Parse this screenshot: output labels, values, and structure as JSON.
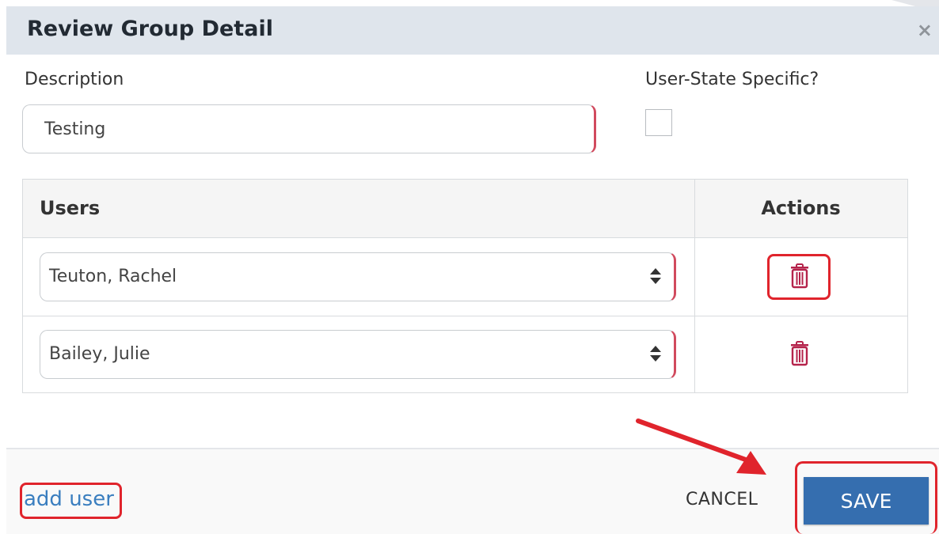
{
  "dialog": {
    "title": "Review Group Detail",
    "close_glyph": "×"
  },
  "form": {
    "description_label": "Description",
    "description_value": "Testing",
    "user_state_label": "User-State Specific?",
    "user_state_checked": false
  },
  "table": {
    "headers": {
      "users": "Users",
      "actions": "Actions"
    },
    "rows": [
      {
        "user": "Teuton, Rachel",
        "action_icon": "trash-icon"
      },
      {
        "user": "Bailey, Julie",
        "action_icon": "trash-icon"
      }
    ]
  },
  "footer": {
    "add_user": "add user",
    "cancel": "CANCEL",
    "save": "SAVE"
  },
  "colors": {
    "header_bg": "#dfe5ec",
    "trash_icon": "#b5234b",
    "save_bg": "#356eaf",
    "link": "#3a7ebf",
    "annotation": "#e0242c"
  }
}
